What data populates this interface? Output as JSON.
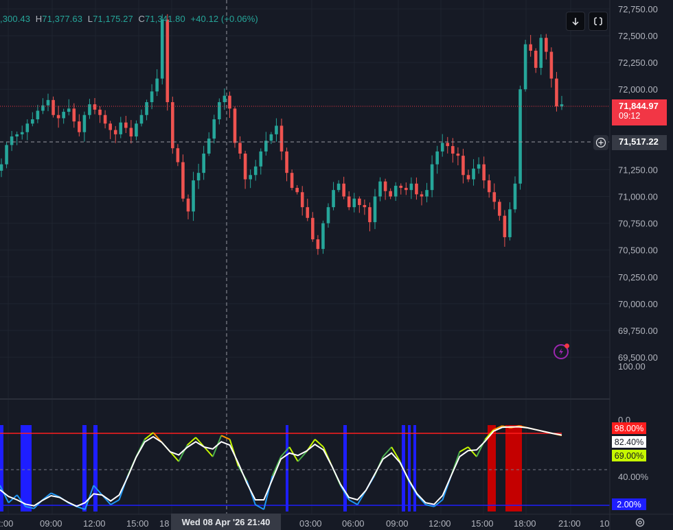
{
  "ohlc": {
    "open": ",300.43",
    "high_label": "H",
    "high": "71,377.63",
    "low_label": "L",
    "low": "71,175.27",
    "close_label": "C",
    "close": "71,341.80",
    "change": "+40.12 (+0.06%)"
  },
  "toolbar": {
    "scroll_icon": "arrow-down-icon",
    "fullscreen_icon": "fullscreen-icon"
  },
  "price_axis": {
    "ticks": [
      "72,750.00",
      "72,500.00",
      "72,250.00",
      "72,000.00",
      "71,250.00",
      "71,000.00",
      "70,750.00",
      "70,500.00",
      "70,250.00",
      "70,000.00",
      "69,750.00",
      "69,500.00"
    ],
    "current_price": "71,844.97",
    "countdown": "09:12",
    "crosshair_price": "71,517.22",
    "crosshair_plus_icon": "plus-circle-icon",
    "alert_icon": "lightning-icon"
  },
  "indicator_axis": {
    "top_label": "100.00",
    "zero_label": "0.0",
    "upper_line": "98.00%",
    "value_white": "82.40%",
    "value_yellow": "69.00%",
    "mid_label": "40.00%",
    "lower_line": "2.00%"
  },
  "time_axis": {
    "labels": [
      "2:00",
      "09:00",
      "12:00",
      "15:00",
      "18",
      "03:00",
      "06:00",
      "09:00",
      "12:00",
      "15:00",
      "18:00",
      "21:00"
    ],
    "hover_label": "Wed 08 Apr '26   21:40",
    "right_label": "10",
    "settings_icon": "gear-icon"
  },
  "colors": {
    "background": "#161a25",
    "up": "#26a69a",
    "down": "#ef5350",
    "price_tag": "#f23645",
    "upper_band": "#ff1e1e",
    "lower_band": "#1e1eff",
    "oscillator": "#ffffff"
  },
  "chart_data": {
    "type": "candlestick",
    "price_ylim": [
      69500,
      72750
    ],
    "current_price": 71844.97,
    "crosshair_price": 71517.22,
    "closes": [
      71300,
      71480,
      71560,
      71580,
      71600,
      71680,
      71720,
      71800,
      71850,
      71900,
      71760,
      71730,
      71790,
      71820,
      71700,
      71600,
      71760,
      71860,
      71810,
      71760,
      71680,
      71620,
      71580,
      71690,
      71640,
      71560,
      71680,
      71760,
      71880,
      71980,
      72100,
      72650,
      71880,
      71450,
      71320,
      70980,
      70860,
      71150,
      71220,
      71400,
      71540,
      71720,
      71880,
      71940,
      71820,
      71500,
      71400,
      71160,
      71200,
      71280,
      71420,
      71520,
      71580,
      71660,
      71420,
      71220,
      71080,
      71040,
      70900,
      70800,
      70600,
      70510,
      70750,
      70900,
      71060,
      71120,
      71000,
      70900,
      70980,
      70920,
      70900,
      70760,
      71000,
      71140,
      71050,
      71000,
      71100,
      71080,
      71060,
      71120,
      71020,
      71000,
      71060,
      71300,
      71420,
      71500,
      71470,
      71400,
      71380,
      71200,
      71160,
      71260,
      71300,
      71150,
      71040,
      70950,
      70820,
      70620,
      70880,
      71120,
      72000,
      72420,
      72360,
      72200,
      72480,
      72350,
      72100,
      71840,
      71860
    ]
  }
}
